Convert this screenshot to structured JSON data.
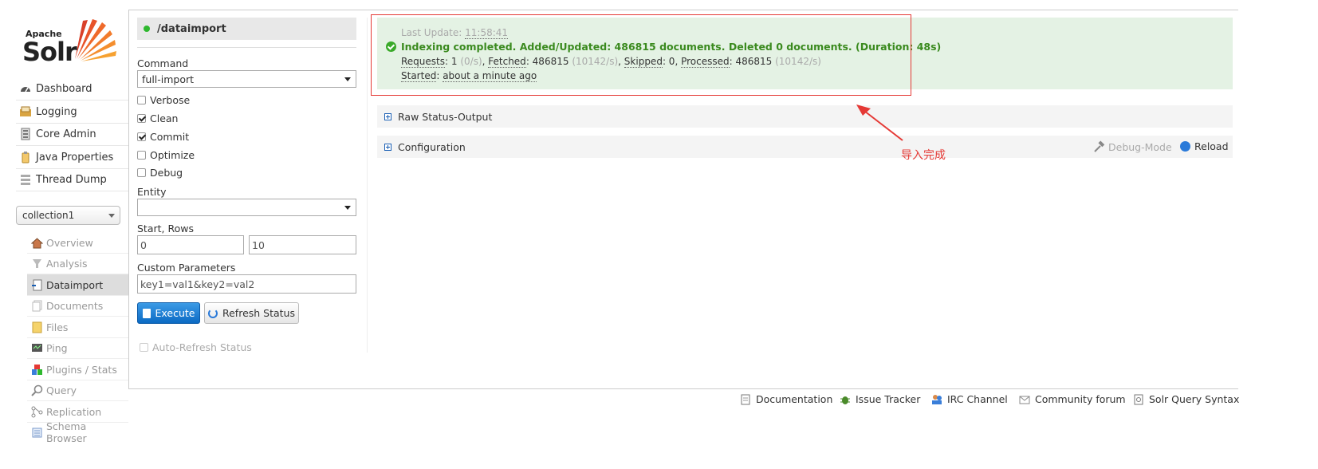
{
  "logo": {
    "apache": "Apache",
    "solr": "Solr"
  },
  "nav": {
    "items": [
      {
        "label": "Dashboard",
        "icon": "dashboard-icon"
      },
      {
        "label": "Logging",
        "icon": "logging-icon"
      },
      {
        "label": "Core Admin",
        "icon": "core-admin-icon"
      },
      {
        "label": "Java Properties",
        "icon": "java-properties-icon"
      },
      {
        "label": "Thread Dump",
        "icon": "thread-dump-icon"
      }
    ],
    "core_selector": "collection1",
    "core_items": [
      {
        "label": "Overview",
        "icon": "overview-icon"
      },
      {
        "label": "Analysis",
        "icon": "analysis-icon"
      },
      {
        "label": "Dataimport",
        "icon": "dataimport-icon"
      },
      {
        "label": "Documents",
        "icon": "documents-icon"
      },
      {
        "label": "Files",
        "icon": "files-icon"
      },
      {
        "label": "Ping",
        "icon": "ping-icon"
      },
      {
        "label": "Plugins / Stats",
        "icon": "plugins-icon"
      },
      {
        "label": "Query",
        "icon": "query-icon"
      },
      {
        "label": "Replication",
        "icon": "replication-icon"
      },
      {
        "label": "Schema Browser",
        "icon": "schema-browser-icon"
      }
    ]
  },
  "form": {
    "handler": "/dataimport",
    "command_label": "Command",
    "command_value": "full-import",
    "verbose_label": "Verbose",
    "clean_label": "Clean",
    "commit_label": "Commit",
    "optimize_label": "Optimize",
    "debug_label": "Debug",
    "entity_label": "Entity",
    "entity_value": "",
    "start_rows_label": "Start, Rows",
    "start_value": "0",
    "rows_value": "10",
    "custom_params_label": "Custom Parameters",
    "custom_params_value": "key1=val1&key2=val2",
    "execute_label": "Execute",
    "refresh_label": "Refresh Status",
    "auto_refresh_label": "Auto-Refresh Status"
  },
  "status": {
    "last_update_label": "Last Update:",
    "last_update_time": "11:58:41",
    "message": "Indexing completed. Added/Updated: 486815 documents. Deleted 0 documents. (Duration: 48s)",
    "requests_label": "Requests",
    "requests_value": "1",
    "requests_rate": "(0/s)",
    "fetched_label": "Fetched",
    "fetched_value": "486815",
    "fetched_rate": "(10142/s)",
    "skipped_label": "Skipped",
    "skipped_value": "0",
    "processed_label": "Processed",
    "processed_value": "486815",
    "processed_rate": "(10142/s)",
    "started_label": "Started",
    "started_value": "about a minute ago"
  },
  "panels": {
    "raw_status": "Raw Status-Output",
    "configuration": "Configuration",
    "debug_mode": "Debug-Mode",
    "reload": "Reload"
  },
  "annotation": "导入完成",
  "footer": [
    {
      "label": "Documentation",
      "icon": "documentation-icon"
    },
    {
      "label": "Issue Tracker",
      "icon": "bug-icon"
    },
    {
      "label": "IRC Channel",
      "icon": "irc-icon"
    },
    {
      "label": "Community forum",
      "icon": "mail-icon"
    },
    {
      "label": "Solr Query Syntax",
      "icon": "query-syntax-icon"
    }
  ],
  "colors": {
    "accent": "#0b6ac4",
    "success": "#3a8a1e",
    "status_bg": "#e4f2e4",
    "annotation": "#e53935"
  }
}
